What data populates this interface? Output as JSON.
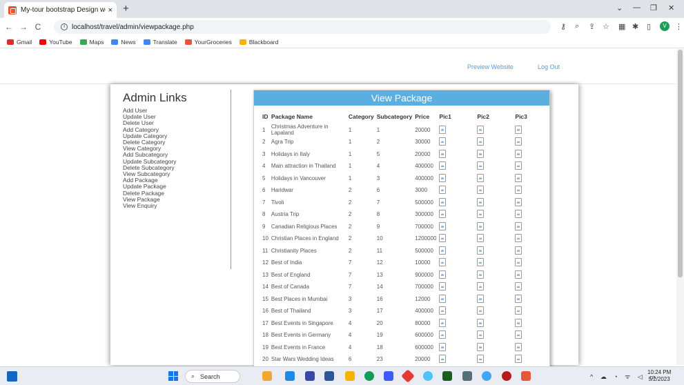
{
  "browser": {
    "tab_title": "My-tour bootstrap Design websi",
    "tab_close": "×",
    "new_tab": "+",
    "url": "localhost/travel/admin/viewpackage.php",
    "back": "←",
    "forward": "→",
    "reload": "C",
    "bookmarks": [
      {
        "label": "Gmail",
        "color": "#d93025"
      },
      {
        "label": "YouTube",
        "color": "#ff0000"
      },
      {
        "label": "Maps",
        "color": "#34a853"
      },
      {
        "label": "News",
        "color": "#4285f4"
      },
      {
        "label": "Translate",
        "color": "#4285f4"
      },
      {
        "label": "YourGroceries",
        "color": "#e8563a"
      },
      {
        "label": "Blackboard",
        "color": "#f4b400"
      }
    ],
    "profile_initial": "V"
  },
  "header": {
    "preview_label": "Preview Website",
    "logout_label": "Log Out"
  },
  "sidebar": {
    "title": "Admin Links",
    "links": [
      "Add User",
      "Update User",
      "Delete User",
      "Add Category",
      "Update Category",
      "Delete Category",
      "View Category",
      "Add Subcategory",
      "Update Subcategory",
      "Delete Subcategory",
      "View Subcategory",
      "Add Package",
      "Update Package",
      "Delete Package",
      "View Package",
      "View Enquiry"
    ]
  },
  "panel": {
    "title": "View Package",
    "columns": [
      "ID",
      "Package Name",
      "Category",
      "Subcategory",
      "Price",
      "Pic1",
      "Pic2",
      "Pic3"
    ],
    "rows": [
      [
        "1",
        "Christmas Adventure in Lapaland",
        "1",
        "1",
        "20000"
      ],
      [
        "2",
        "Agra Trip",
        "1",
        "2",
        "30000"
      ],
      [
        "3",
        "Holidays in Italy",
        "1",
        "5",
        "20000"
      ],
      [
        "4",
        "Main attraction in Thailand",
        "1",
        "4",
        "400000"
      ],
      [
        "5",
        "Holidays in Vancouver",
        "1",
        "3",
        "400000"
      ],
      [
        "6",
        "Haridwar",
        "2",
        "6",
        "3000"
      ],
      [
        "7",
        "Tivoli",
        "2",
        "7",
        "500000"
      ],
      [
        "8",
        "Austria Trip",
        "2",
        "8",
        "300000"
      ],
      [
        "9",
        "Canadian Religious Places",
        "2",
        "9",
        "700000"
      ],
      [
        "10",
        "Christian Places in England",
        "2",
        "10",
        "1200000"
      ],
      [
        "11",
        "Christianity Places",
        "2",
        "11",
        "500000"
      ],
      [
        "12",
        "Best of India",
        "7",
        "12",
        "10000"
      ],
      [
        "13",
        "Best of England",
        "7",
        "13",
        "900000"
      ],
      [
        "14",
        "Best of Canada",
        "7",
        "14",
        "700000"
      ],
      [
        "15",
        "Best Places in Mumbai",
        "3",
        "16",
        "12000"
      ],
      [
        "16",
        "Best of Thailand",
        "3",
        "17",
        "400000"
      ],
      [
        "17",
        "Best Events in Singapore",
        "4",
        "20",
        "80000"
      ],
      [
        "18",
        "Best Events in Germany",
        "4",
        "19",
        "600000"
      ],
      [
        "19",
        "Best Events in France",
        "4",
        "18",
        "600000"
      ],
      [
        "20",
        "Star Wars Wedding Ideas",
        "6",
        "23",
        "20000"
      ]
    ]
  },
  "taskbar": {
    "search_label": "Search",
    "time": "10:24 PM",
    "date": "5/2/2023"
  }
}
